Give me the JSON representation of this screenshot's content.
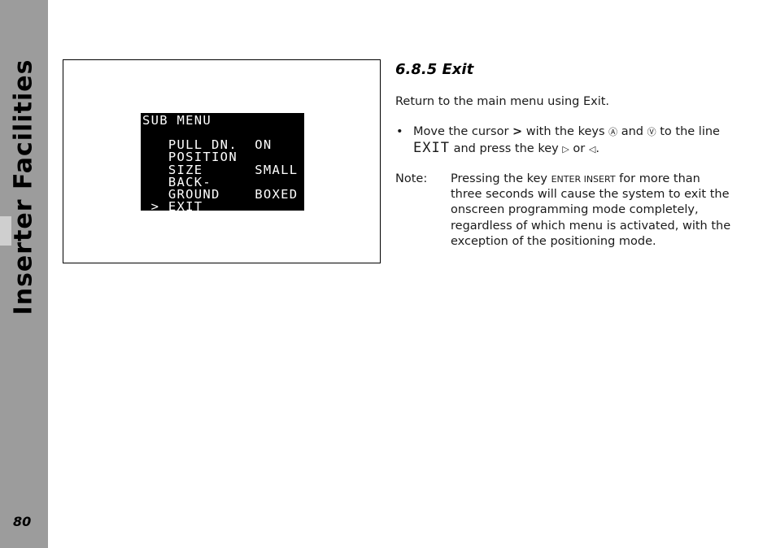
{
  "sidebar": {
    "title": "Inserter Facilities",
    "page_number": "80"
  },
  "figure": {
    "osd_lines": [
      "SUB MENU",
      "   PULL DN.  ON",
      "   POSITION",
      "   SIZE      SMALL",
      "   BACK-",
      "   GROUND    BOXED",
      " > EXIT"
    ]
  },
  "section": {
    "heading": "6.8.5  Exit",
    "intro": "Return to the main menu using Exit.",
    "bullet": {
      "marker": "•",
      "part1": "Move the cursor",
      "cursor_glyph": ">",
      "part2": "with the keys",
      "key_up_icon": "up-arrow-key-icon",
      "key_up_glyph": "Ⓐ",
      "and": "and",
      "key_down_icon": "down-arrow-key-icon",
      "key_down_glyph": "Ⓥ",
      "part3": "to the line",
      "exit_word": "EXIT",
      "part4": "and press the key",
      "key_right_glyph": "▷",
      "or": "or",
      "key_left_glyph": "◁",
      "end": "."
    },
    "note": {
      "label": "Note:",
      "line1_pre": "Pressing the key",
      "key_name": "Enter Insert",
      "line1_post": "for more than",
      "line2": "three seconds will cause the system to exit the",
      "line3": "onscreen programming mode completely,",
      "line4": "regardless of which menu is activated, with the",
      "line5": "exception of the positioning mode."
    }
  }
}
